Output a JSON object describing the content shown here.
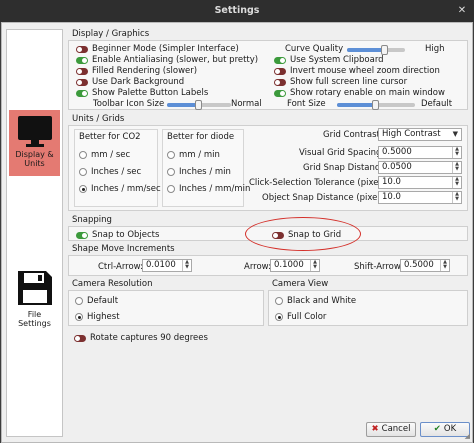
{
  "window": {
    "title": "Settings",
    "close_glyph": "✕"
  },
  "sidebar": {
    "items": [
      {
        "label1": "Display &",
        "label2": "Units",
        "icon": "monitor-icon",
        "active": true
      },
      {
        "label1": "File",
        "label2": "Settings",
        "icon": "floppy-disk-icon",
        "active": false
      }
    ]
  },
  "display_graphics": {
    "title": "Display / Graphics",
    "left": [
      {
        "label": "Beginner Mode (Simpler Interface)",
        "on": false
      },
      {
        "label": "Enable Antialiasing (slower, but pretty)",
        "on": true
      },
      {
        "label": "Filled Rendering (slower)",
        "on": false
      },
      {
        "label": "Use Dark Background",
        "on": false
      },
      {
        "label": "Show Palette Button Labels",
        "on": true
      }
    ],
    "toolbar_icon_size": {
      "label": "Toolbar Icon Size",
      "value_text": "Normal",
      "level": 0.5
    },
    "curve_quality": {
      "label": "Curve Quality",
      "value_text": "High",
      "level": 0.65
    },
    "right": [
      {
        "label": "Use System Clipboard",
        "on": true
      },
      {
        "label": "Invert mouse wheel zoom direction",
        "on": false
      },
      {
        "label": "Show full screen line cursor",
        "on": false
      },
      {
        "label": "Show rotary enable on main window",
        "on": true
      }
    ],
    "font_size": {
      "label": "Font Size",
      "value_text": "Default",
      "level": 0.5
    }
  },
  "units_grids": {
    "title": "Units / Grids",
    "co2": {
      "title": "Better for CO2",
      "options": [
        "mm / sec",
        "Inches / sec",
        "Inches / mm/sec"
      ],
      "selected": 2
    },
    "diode": {
      "title": "Better for diode",
      "options": [
        "mm / min",
        "Inches / min",
        "Inches / mm/min"
      ],
      "selected": -1
    },
    "grid_contrast": {
      "label": "Grid Contrast",
      "value": "High Contrast"
    },
    "fields": [
      {
        "label": "Visual Grid Spacing",
        "value": "0.5000"
      },
      {
        "label": "Grid Snap Distance",
        "value": "0.0500"
      },
      {
        "label": "Click-Selection Tolerance (pixels)",
        "value": "10.0"
      },
      {
        "label": "Object Snap Distance (pixels)",
        "value": "10.0"
      }
    ]
  },
  "snapping": {
    "title": "Snapping",
    "snap_objects": {
      "label": "Snap to Objects",
      "on": true
    },
    "snap_grid": {
      "label": "Snap to Grid",
      "on": false
    }
  },
  "shape_move": {
    "title": "Shape Move Increments",
    "ctrl": {
      "label": "Ctrl-Arrow:",
      "value": "0.0100"
    },
    "arrow": {
      "label": "Arrow:",
      "value": "0.1000"
    },
    "shift": {
      "label": "Shift-Arrow:",
      "value": "0.5000"
    }
  },
  "camera_resolution": {
    "title": "Camera Resolution",
    "options": [
      "Default",
      "Highest"
    ],
    "selected": 1
  },
  "camera_view": {
    "title": "Camera View",
    "options": [
      "Black and White",
      "Full Color"
    ],
    "selected": 1
  },
  "rotate_captures": {
    "label": "Rotate captures 90 degrees",
    "on": false
  },
  "buttons": {
    "cancel": "Cancel",
    "ok": "OK"
  },
  "colors": {
    "accent": "#5d8fd6",
    "toggle_on": "#3c9a3c",
    "toggle_off": "#7c3030",
    "active_sidebar": "#e47a72",
    "annotation": "#d4302a"
  }
}
